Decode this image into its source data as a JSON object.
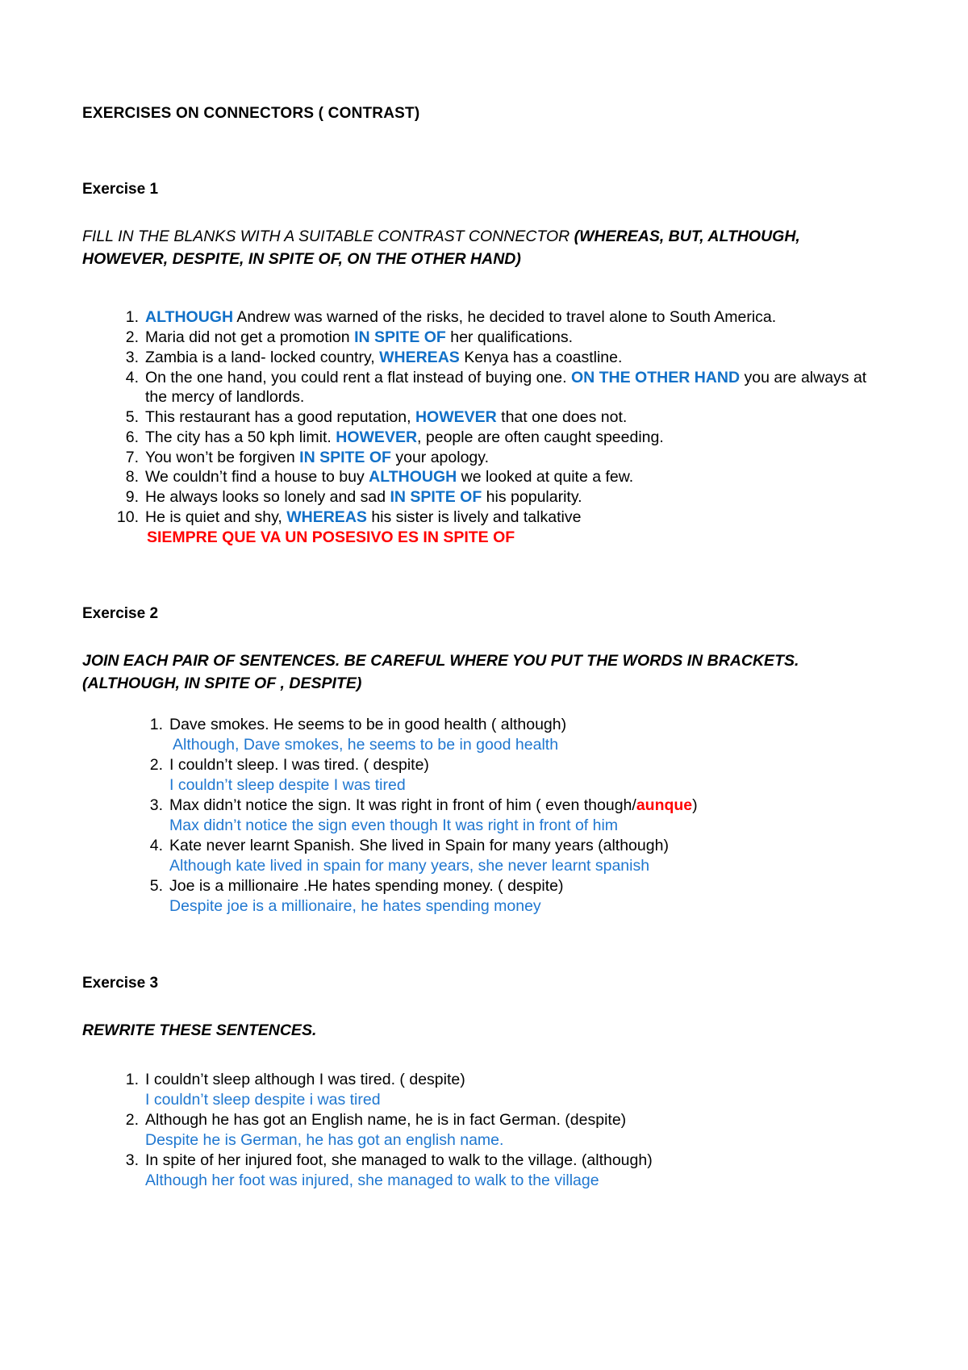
{
  "document": {
    "title": "EXERCISES ON CONNECTORS  ( CONTRAST)"
  },
  "exercise1": {
    "heading": "Exercise 1",
    "instruction_plain": "FILL IN THE BLANKS WITH A SUITABLE CONTRAST CONNECTOR ",
    "instruction_bold": "(WHEREAS, BUT, ALTHOUGH, HOWEVER, DESPITE, IN SPITE OF, ON THE OTHER HAND)",
    "items": [
      {
        "num": "1.",
        "pre": "",
        "connector": "ALTHOUGH",
        "post": " Andrew was warned of the risks, he decided to travel alone to South America."
      },
      {
        "num": "2.",
        "pre": "Maria did not get a promotion ",
        "connector": "IN SPITE OF",
        "post": " her qualifications."
      },
      {
        "num": "3.",
        "pre": "Zambia is a land- locked country, ",
        "connector": "WHEREAS",
        "post": " Kenya has a coastline."
      },
      {
        "num": "4.",
        "pre": "On the one hand, you could rent a flat instead of buying one. ",
        "connector": "ON THE OTHER HAND",
        "post": " you are always at the mercy of landlords."
      },
      {
        "num": "5.",
        "pre": "This restaurant has a good reputation, ",
        "connector": "HOWEVER",
        "post": " that one does not."
      },
      {
        "num": "6.",
        "pre": "The city has a 50 kph limit. ",
        "connector": "HOWEVER",
        "post": ", people are often caught speeding."
      },
      {
        "num": "7.",
        "pre": "You won’t be forgiven ",
        "connector": "IN SPITE OF",
        "post": " your apology."
      },
      {
        "num": "8.",
        "pre": "We couldn’t find a house to buy ",
        "connector": "ALTHOUGH",
        "post": " we looked at quite a few."
      },
      {
        "num": "9.",
        "pre": "He always looks so lonely and sad ",
        "connector": "IN SPITE OF",
        "post": " his popularity."
      },
      {
        "num": "10.",
        "pre": "He is quiet and shy, ",
        "connector": "WHEREAS",
        "post": " his sister is lively and talkative"
      }
    ],
    "note_red": "SIEMPRE QUE VA UN POSESIVO ES IN SPITE OF"
  },
  "exercise2": {
    "heading": "Exercise 2",
    "instruction": "JOIN EACH PAIR OF SENTENCES. BE CAREFUL WHERE YOU PUT THE WORDS IN BRACKETS. (ALTHOUGH, IN SPITE OF , DESPITE)",
    "items": [
      {
        "num": "1.",
        "prompt": "Dave smokes. He seems to be in good health ( although)",
        "answer": "Although, Dave smokes, he seems to be in good health"
      },
      {
        "num": "2.",
        "prompt": "I couldn’t sleep. I was tired. ( despite)",
        "answer": "I couldn’t sleep despite I was tired"
      },
      {
        "num": "3.",
        "prompt_pre": "Max didn’t notice the sign. It was right in front of him ( even though/",
        "prompt_red": "aunque",
        "prompt_post": ")",
        "answer": " Max didn’t notice the sign even though It was right in front of him"
      },
      {
        "num": "4.",
        "prompt": "Kate never learnt Spanish. She lived in Spain for many years (although)",
        "answer": "Although kate lived in spain for many years, she never learnt spanish"
      },
      {
        "num": "5.",
        "prompt": "Joe is a millionaire .He hates  spending money. ( despite)",
        "answer": "Despite joe is a millionaire, he hates spending money"
      }
    ]
  },
  "exercise3": {
    "heading": "Exercise 3",
    "instruction": "REWRITE THESE SENTENCES.",
    "items": [
      {
        "num": "1.",
        "prompt": "I  couldn’t sleep although I was tired. ( despite)",
        "answer": "I couldn’t sleep despite i was tired"
      },
      {
        "num": "2.",
        "prompt": "Although he has got an English name, he is in fact German. (despite)",
        "answer": "Despite he is German, he has got an english name."
      },
      {
        "num": "3.",
        "prompt": "In spite of her injured foot, she managed to walk to the village. (although)",
        "answer": "Although her foot was injured, she managed to walk to the village"
      }
    ]
  },
  "colors": {
    "connector_blue": "#1170c7",
    "answer_blue": "#1f77d0",
    "note_red": "#ff0000"
  }
}
